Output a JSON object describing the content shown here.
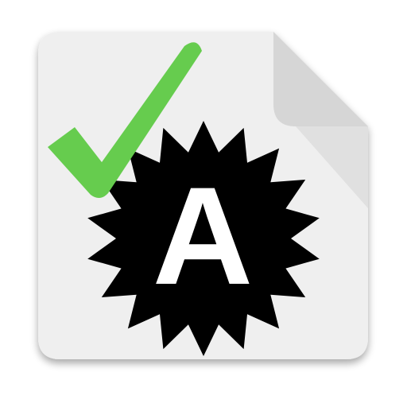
{
  "icon": {
    "depicts": [
      "document-icon",
      "check-icon",
      "badge-icon"
    ],
    "badge_letter": "A",
    "badge_points": 18
  },
  "colors": {
    "page": "#EFEFEF",
    "page_fold": "#D6D6D6",
    "check": "#66CC4E",
    "badge": "#000000",
    "letter": "#FFFFFF"
  }
}
